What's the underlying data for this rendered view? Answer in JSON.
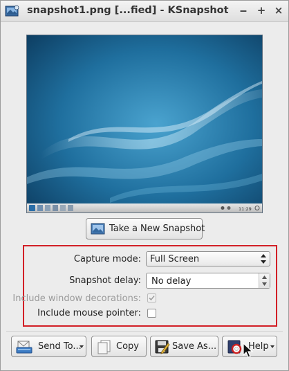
{
  "window": {
    "title": "snapshot1.png [...fied] - KSnapshot",
    "minimize_glyph": "‒",
    "maximize_glyph": "+",
    "close_glyph": "×",
    "accent_color": "#1d5b82"
  },
  "preview": {
    "taskbar_clock": "11:29"
  },
  "snapshot_button": {
    "label": "Take a New Snapshot"
  },
  "options": {
    "capture_mode_label": "Capture mode:",
    "capture_mode_value": "Full Screen",
    "snapshot_delay_label": "Snapshot delay:",
    "snapshot_delay_value": "No delay",
    "include_decorations_label": "Include window decorations:",
    "include_decorations_checked": true,
    "include_decorations_enabled": false,
    "include_pointer_label": "Include mouse pointer:",
    "include_pointer_checked": false,
    "highlight_color": "#d21f26"
  },
  "actions": {
    "send_label": "Send To...",
    "copy_label": "Copy",
    "save_label": "Save As...",
    "help_label": "Help"
  }
}
